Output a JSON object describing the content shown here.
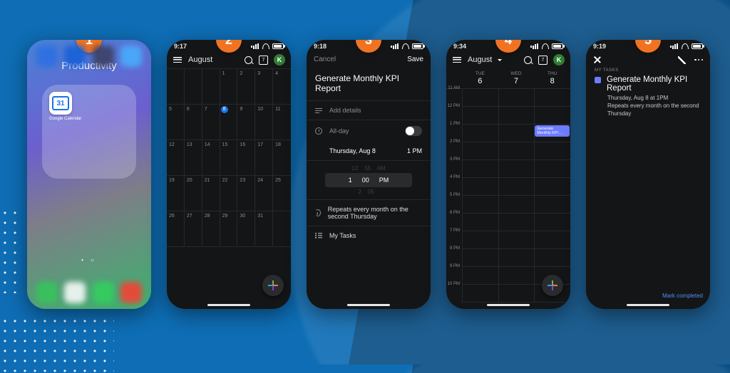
{
  "badges": [
    "1",
    "2",
    "3",
    "4",
    "5"
  ],
  "phone1": {
    "folder_title": "Productivity",
    "app_label": "Google Calendar",
    "app_day": "31"
  },
  "phone2": {
    "time": "9:17",
    "month": "August",
    "today_box": "7",
    "avatar": "K",
    "days": [
      "",
      "",
      "",
      "1",
      "2",
      "3",
      "4",
      "5",
      "6",
      "7",
      "8",
      "9",
      "10",
      "11",
      "12",
      "13",
      "14",
      "15",
      "16",
      "17",
      "18",
      "19",
      "20",
      "21",
      "22",
      "23",
      "24",
      "25",
      "26",
      "27",
      "28",
      "29",
      "30",
      "31",
      ""
    ],
    "today_index": 10
  },
  "phone3": {
    "time": "9:18",
    "cancel": "Cancel",
    "save": "Save",
    "title": "Generate Monthly KPI Report",
    "add_details": "Add details",
    "all_day": "All-day",
    "date": "Thursday, Aug 8",
    "date_time": "1 PM",
    "wheel_above": {
      "h": "12",
      "m": "55",
      "ap": "AM"
    },
    "wheel_sel": {
      "h": "1",
      "m": "00",
      "ap": "PM"
    },
    "wheel_below": {
      "h": "2",
      "m": "05",
      "ap": ""
    },
    "repeat": "Repeats every month on the second Thursday",
    "list": "My Tasks"
  },
  "phone4": {
    "time": "9:34",
    "month": "August",
    "today_box": "7",
    "avatar": "K",
    "cols": [
      {
        "dow": "TUE",
        "d": "6"
      },
      {
        "dow": "WED",
        "d": "7"
      },
      {
        "dow": "THU",
        "d": "8"
      }
    ],
    "hours": [
      "11 AM",
      "12 PM",
      "1 PM",
      "2 PM",
      "3 PM",
      "4 PM",
      "5 PM",
      "6 PM",
      "7 PM",
      "8 PM",
      "9 PM",
      "10 PM"
    ],
    "event": "Generate Monthly KPI …"
  },
  "phone5": {
    "time": "9:19",
    "label": "MY TASKS",
    "title": "Generate Monthly KPI Report",
    "sub1": "Thursday, Aug 8 at 1PM",
    "sub2": "Repeats every month on the second Thursday",
    "complete": "Mark completed"
  }
}
